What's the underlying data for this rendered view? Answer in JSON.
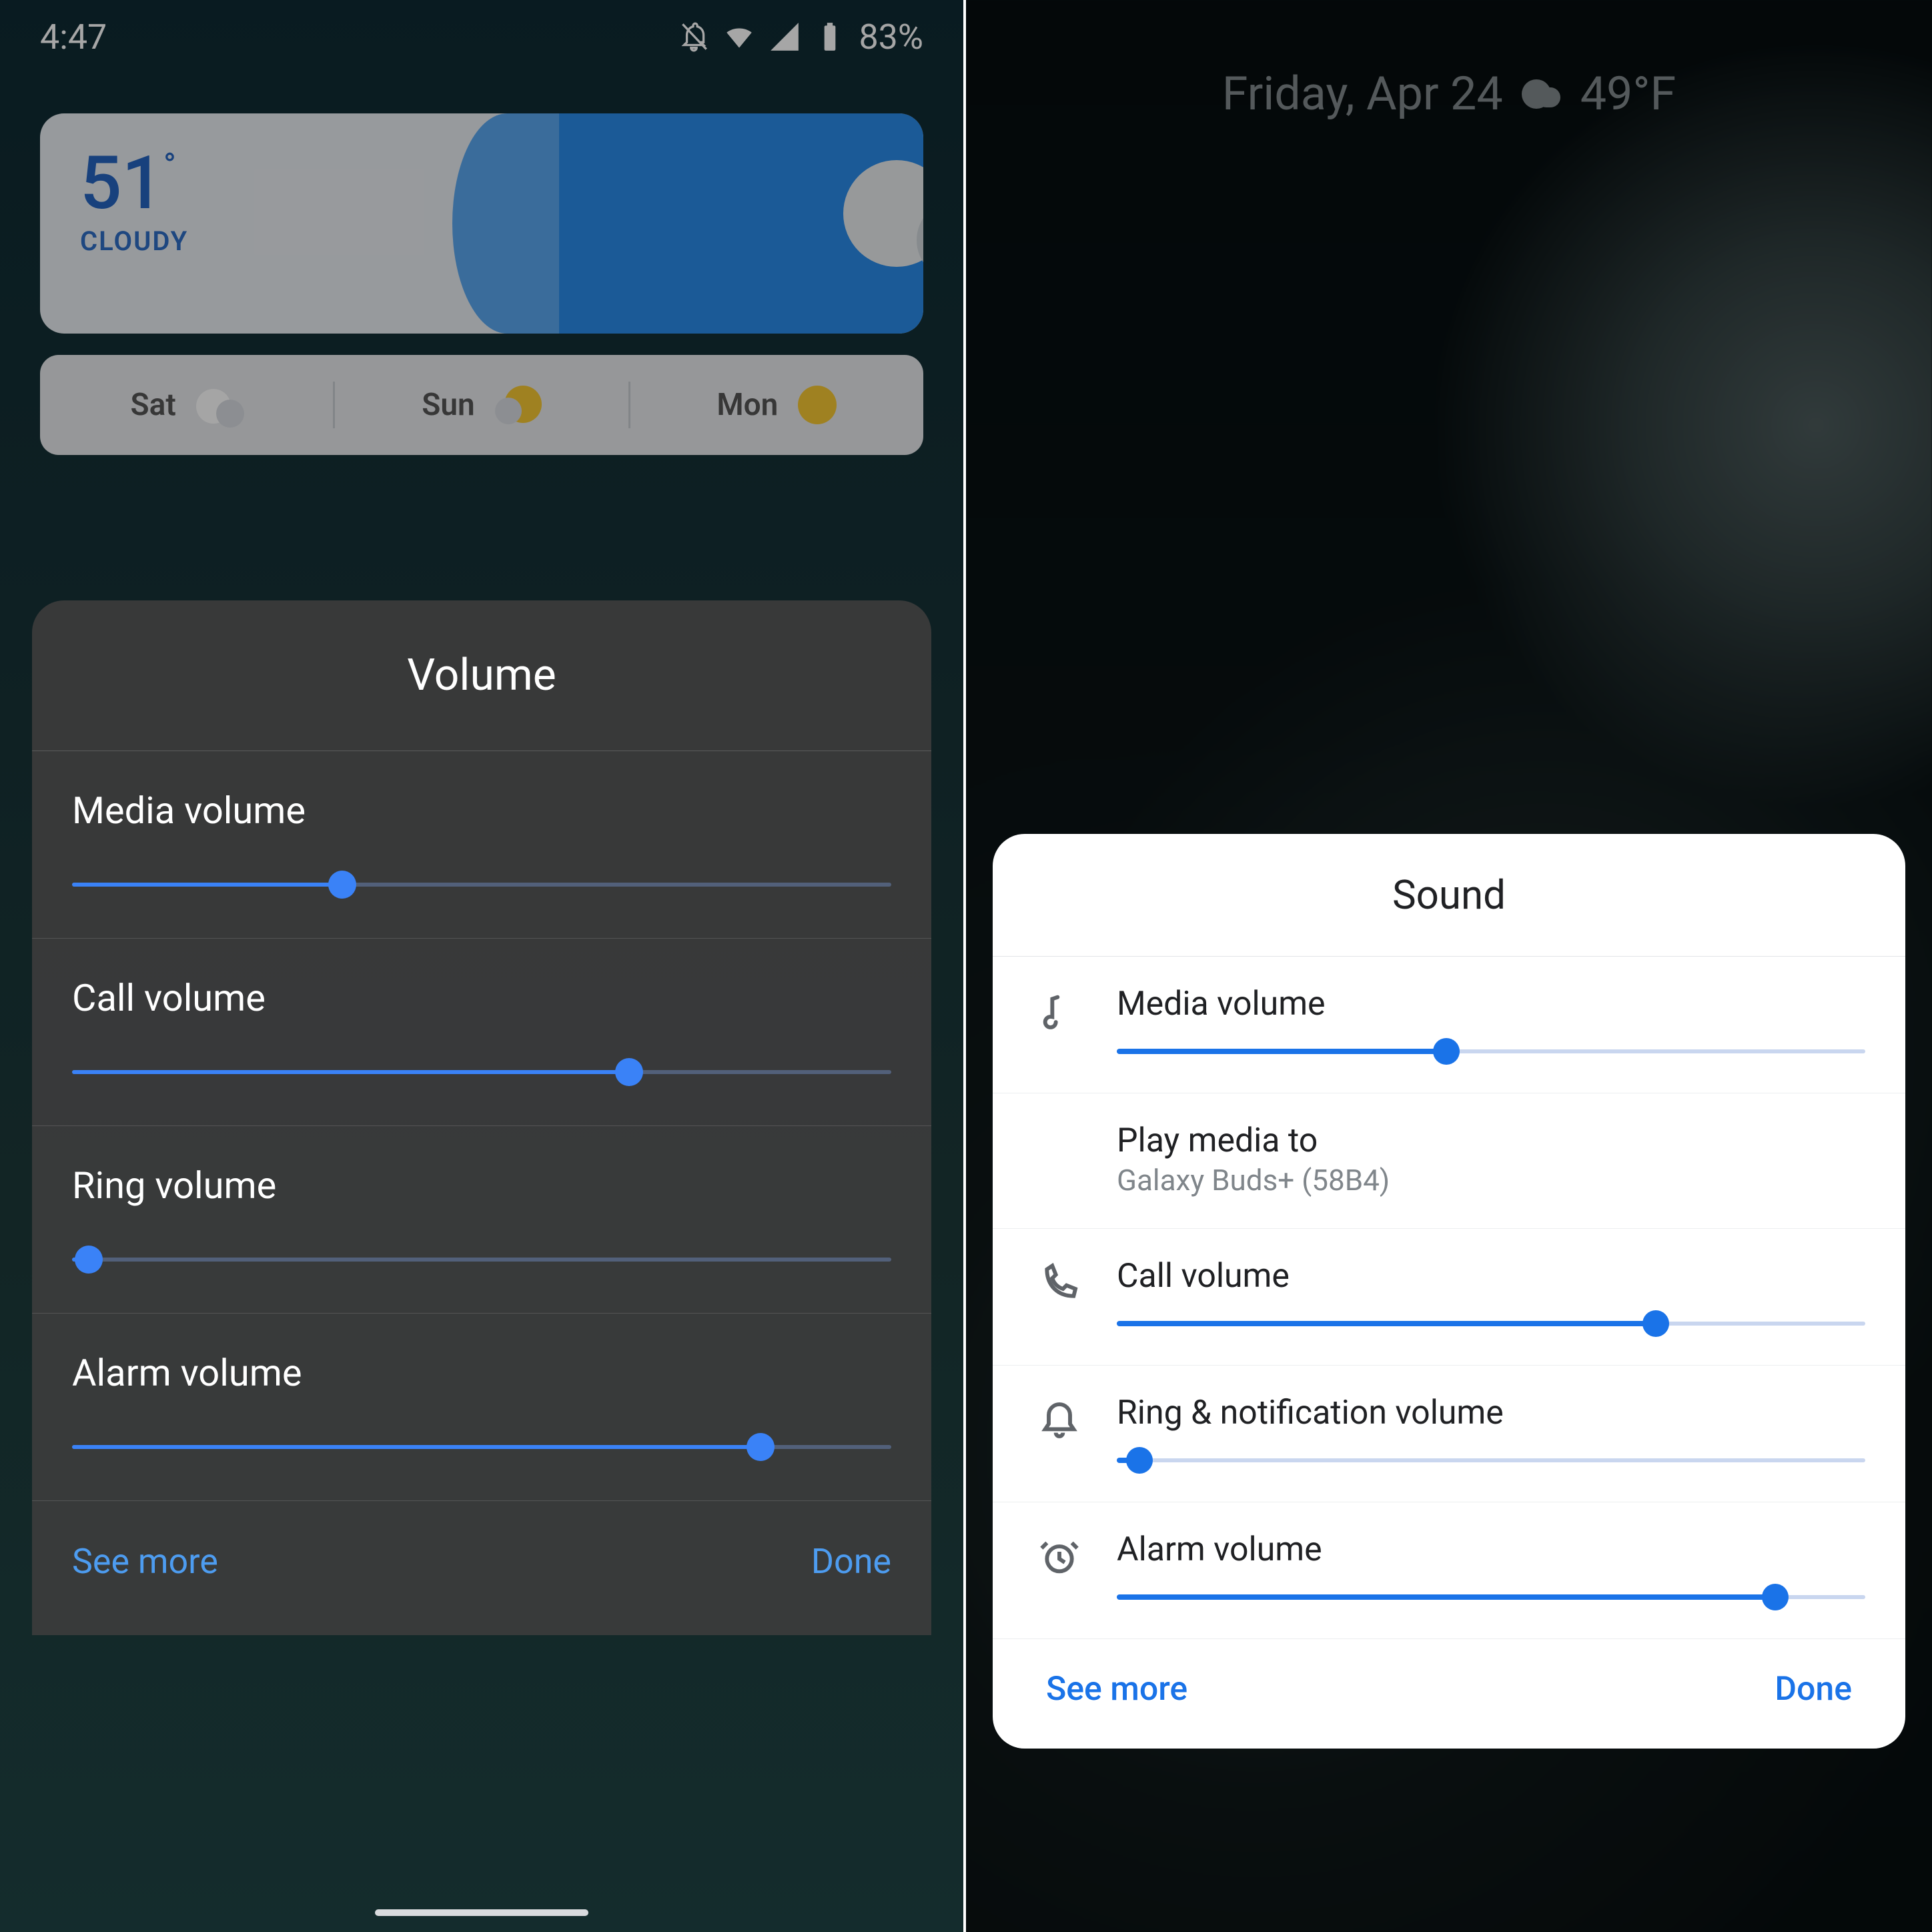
{
  "left": {
    "status": {
      "time": "4:47",
      "battery": "83%"
    },
    "weather": {
      "temp": "51",
      "condition": "CLOUDY",
      "forecast": [
        {
          "day": "Sat",
          "icon": "cloud"
        },
        {
          "day": "Sun",
          "icon": "suncloud"
        },
        {
          "day": "Mon",
          "icon": "sun"
        }
      ]
    },
    "panel": {
      "title": "Volume",
      "rows": [
        {
          "label": "Media volume",
          "value": 33
        },
        {
          "label": "Call volume",
          "value": 68
        },
        {
          "label": "Ring volume",
          "value": 2
        },
        {
          "label": "Alarm volume",
          "value": 84
        }
      ],
      "see_more": "See more",
      "done": "Done"
    }
  },
  "right": {
    "lock": {
      "date": "Friday, Apr 24",
      "temp": "49°F"
    },
    "panel": {
      "title": "Sound",
      "media": {
        "label": "Media volume",
        "value": 44
      },
      "output": {
        "label": "Play media to",
        "device": "Galaxy Buds+ (58B4)"
      },
      "call": {
        "label": "Call volume",
        "value": 72
      },
      "ring": {
        "label": "Ring & notification volume",
        "value": 3
      },
      "alarm": {
        "label": "Alarm volume",
        "value": 88
      },
      "see_more": "See more",
      "done": "Done"
    }
  }
}
